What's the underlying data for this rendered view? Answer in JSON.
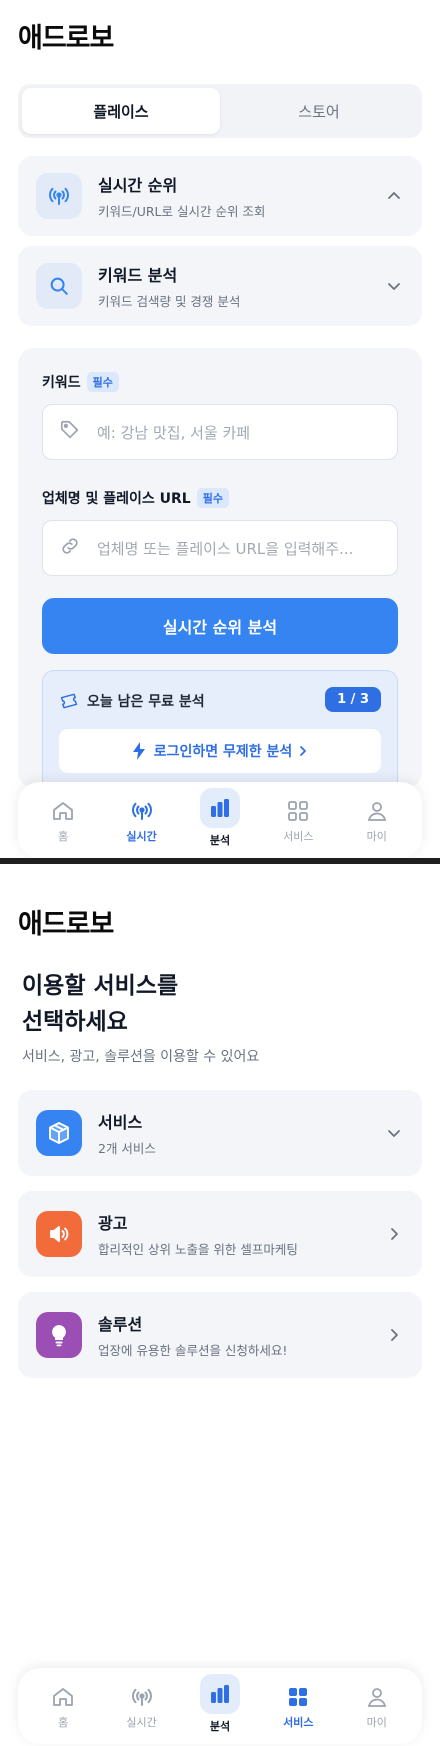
{
  "app": {
    "logo": "애드로보"
  },
  "screen1": {
    "segmented": {
      "tabs": [
        {
          "label": "플레이스",
          "active": true
        },
        {
          "label": "스토어",
          "active": false
        }
      ]
    },
    "accordion": [
      {
        "title": "실시간 순위",
        "subtitle": "키워드/URL로 실시간 순위 조회",
        "icon": "signal-icon",
        "expanded": true
      },
      {
        "title": "키워드 분석",
        "subtitle": "키워드 검색량 및 경쟁 분석",
        "icon": "search-icon",
        "expanded": false
      }
    ],
    "form": {
      "keyword": {
        "label": "키워드",
        "required_badge": "필수",
        "placeholder": "예: 강남 맛집, 서울 카페"
      },
      "business": {
        "label": "업체명 및 플레이스 URL",
        "required_badge": "필수",
        "placeholder": "업체명 또는 플레이스 URL을 입력해주..."
      },
      "submit_label": "실시간 순위 분석",
      "free_box": {
        "title": "오늘 남은 무료 분석",
        "count": "1 / 3",
        "login_cta": "로그인하면 무제한 분석"
      }
    }
  },
  "screen2": {
    "headline_line1": "이용할 서비스를",
    "headline_line2": "선택하세요",
    "subhead": "서비스, 광고, 솔루션을 이용할 수 있어요",
    "services": [
      {
        "title": "서비스",
        "subtitle": "2개 서비스",
        "icon": "box-icon",
        "color": "#3584f2"
      },
      {
        "title": "광고",
        "subtitle": "합리적인 상위 노출을 위한 셀프마케팅",
        "icon": "megaphone-icon",
        "color": "#f26b3a"
      },
      {
        "title": "솔루션",
        "subtitle": "업장에 유용한 솔루션을 신청하세요!",
        "icon": "lightbulb-icon",
        "color": "#9b4fb5"
      }
    ]
  },
  "nav": {
    "items": [
      {
        "label": "홈",
        "icon": "home-icon"
      },
      {
        "label": "실시간",
        "icon": "signal-icon"
      },
      {
        "label": "분석",
        "icon": "bar-chart-icon"
      },
      {
        "label": "서비스",
        "icon": "grid-icon"
      },
      {
        "label": "마이",
        "icon": "user-icon"
      }
    ],
    "screen1_active": "실시간",
    "screen2_active": "서비스"
  },
  "colors": {
    "primary": "#3584f2",
    "accent_text": "#2f6fe4",
    "card_bg": "#f3f5f8"
  }
}
